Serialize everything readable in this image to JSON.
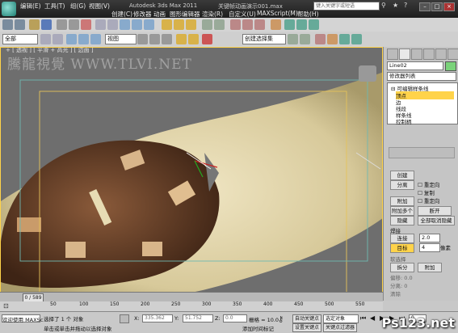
{
  "app": {
    "title": "Autodesk 3ds Max  2011",
    "file_title": "关键帧动画演示001.max",
    "search_placeholder": "键入关键字或短语"
  },
  "menu": [
    "编辑(E)",
    "工具(T)",
    "组(G)",
    "视图(V)",
    "创建(C)",
    "修改器",
    "动画",
    "图形编辑器",
    "渲染(R)",
    "自定义(U)",
    "MAXScript(M)",
    "帮助(H)"
  ],
  "toolbar": {
    "selection_filter": "全部",
    "ref_coord": "视图",
    "named_selection": "创建选择集"
  },
  "viewport": {
    "label": "+ [ 透视 ] [ 平滑 + 高光 ] [ 边面 ]",
    "watermark": "騰龍視覺 WWW.TLVI.NET"
  },
  "command_panel": {
    "object_name": "Line02",
    "modifier_list_label": "修改器列表",
    "stack": {
      "root": "可编辑样条线",
      "items": [
        "顶点",
        "边",
        "线段",
        "样条线",
        "控制柄"
      ],
      "selected": "顶点"
    },
    "rollout": {
      "buttons": [
        "创建",
        "分离",
        "附加",
        "附加多个",
        "断开",
        "隐藏",
        "全部取消隐藏"
      ],
      "checks": [
        "重定向",
        "复制",
        "重定向"
      ],
      "pivot_label": "焊接",
      "connect_label": "连接",
      "weld_value": "2.0",
      "target_label": "目标",
      "target_value": "4",
      "pixel_label": "像素",
      "sec2_title": "软选择",
      "sec2_items": [
        "拆分",
        "附加"
      ],
      "bottom_labels": [
        "偏移: 0.0",
        "分离: 0",
        "清除"
      ]
    }
  },
  "timeline": {
    "frame_display": "0 / 589",
    "ticks": [
      "0",
      "50",
      "100",
      "150",
      "200",
      "250",
      "300",
      "350",
      "400",
      "450",
      "500",
      "550"
    ]
  },
  "status": {
    "script_label": "欢迎使用 MAXSc",
    "selected": "选择了 1 个 对象",
    "prompt": "单击或单击并拖动以选择对象",
    "x_label": "X:",
    "x_value": "335.362",
    "y_label": "Y:",
    "y_value": "51.752",
    "z_label": "Z:",
    "z_value": "0.0",
    "grid": "栅格 = 10.0",
    "add_time_tag": "添加时间标记",
    "auto_key": "自动关键点",
    "set_key": "设置关键点",
    "key_filter": "关键点过滤器",
    "selection_set": "选定对象",
    "frame_value": "0"
  },
  "watermark_corner": "Ps123.net",
  "colors": {
    "accent": "#ffd34a",
    "titlebar": "#2a2a2a",
    "viewport_bg": "#6e6e6e"
  }
}
